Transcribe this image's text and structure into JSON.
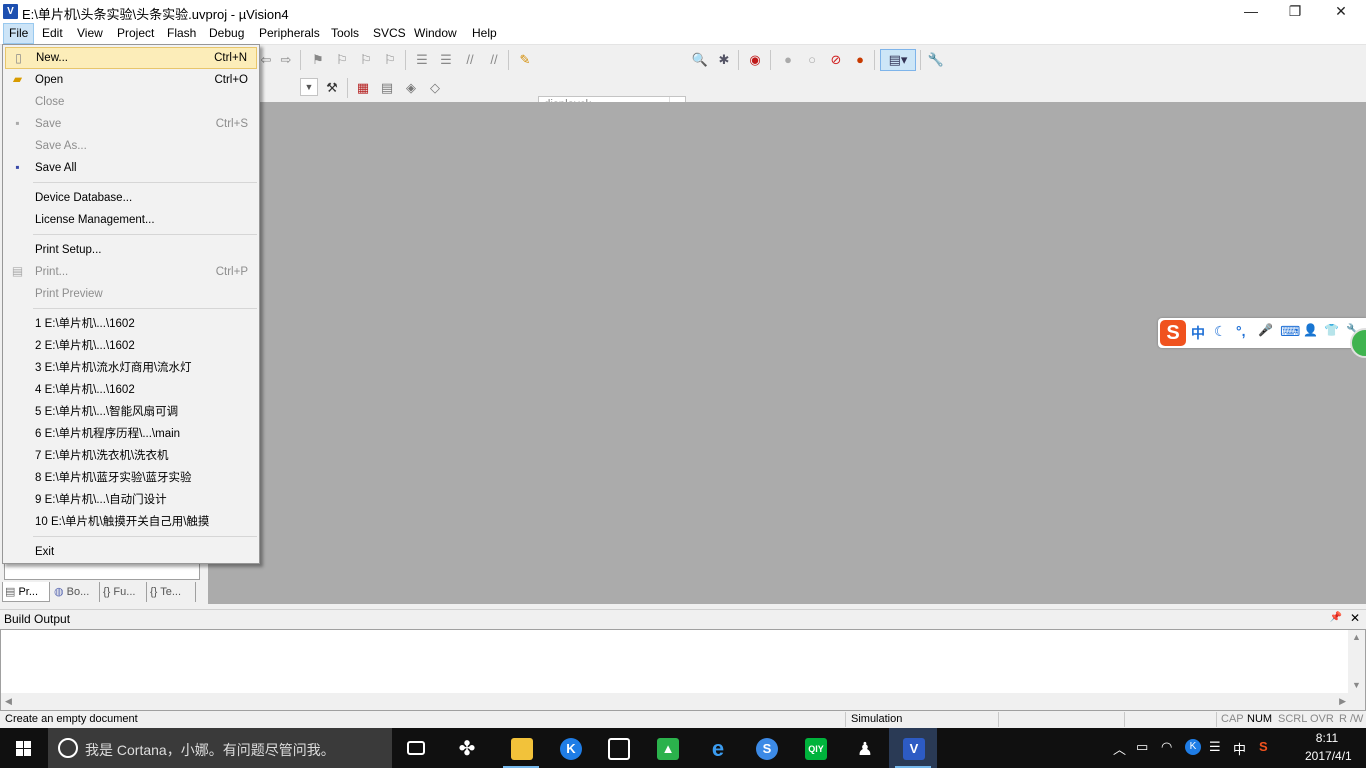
{
  "window": {
    "title": "E:\\单片机\\头条实验\\头条实验.uvproj - µVision4",
    "app_icon_text": "V",
    "controls": {
      "minimize": "—",
      "restore": "❐",
      "close": "✕"
    }
  },
  "menubar": {
    "items": [
      "File",
      "Edit",
      "View",
      "Project",
      "Flash",
      "Debug",
      "Peripherals",
      "Tools",
      "SVCS",
      "Window",
      "Help"
    ]
  },
  "toolbar": {
    "target_select": "displayck"
  },
  "file_menu": {
    "items": [
      {
        "label": "New...",
        "shortcut": "Ctrl+N",
        "icon": "new-file-icon",
        "highlighted": true,
        "disabled": false
      },
      {
        "label": "Open",
        "shortcut": "Ctrl+O",
        "icon": "open-folder-icon",
        "disabled": false
      },
      {
        "label": "Close",
        "shortcut": "",
        "disabled": true
      },
      {
        "label": "Save",
        "shortcut": "Ctrl+S",
        "icon": "save-icon",
        "disabled": true
      },
      {
        "label": "Save As...",
        "shortcut": "",
        "disabled": true
      },
      {
        "label": "Save All",
        "shortcut": "",
        "icon": "save-all-icon",
        "disabled": false
      },
      {
        "label": "Device Database...",
        "shortcut": "",
        "disabled": false
      },
      {
        "label": "License Management...",
        "shortcut": "",
        "disabled": false
      },
      {
        "label": "Print Setup...",
        "shortcut": "",
        "disabled": false
      },
      {
        "label": "Print...",
        "shortcut": "Ctrl+P",
        "icon": "print-icon",
        "disabled": true
      },
      {
        "label": "Print Preview",
        "shortcut": "",
        "disabled": true
      }
    ],
    "recent_files": [
      "1 E:\\单片机\\...\\1602",
      "2 E:\\单片机\\...\\1602",
      "3 E:\\单片机\\流水灯商用\\流水灯",
      "4 E:\\单片机\\...\\1602",
      "5 E:\\单片机\\...\\智能风扇可调",
      "6 E:\\单片机程序历程\\...\\main",
      "7 E:\\单片机\\洗衣机\\洗衣机",
      "8 E:\\单片机\\蓝牙实验\\蓝牙实验",
      "9 E:\\单片机\\...\\自动门设计",
      "10 E:\\单片机\\触摸开关自己用\\触摸"
    ],
    "exit": "Exit"
  },
  "panel_tabs": [
    "Pr...",
    "Bo...",
    "Fu...",
    "Te..."
  ],
  "build_output": {
    "title": "Build Output",
    "pin": "📌",
    "close": "✕"
  },
  "statusbar": {
    "message": "Create an empty document",
    "mode": "Simulation",
    "indicators": [
      "CAP",
      "NUM",
      "SCRL",
      "OVR",
      "R /W"
    ]
  },
  "ime_bar": {
    "logo": "S",
    "items": [
      "中",
      "☾",
      "°,",
      "🎤",
      "⌨",
      "👤",
      "👕",
      "🔧"
    ]
  },
  "taskbar": {
    "search_placeholder": "我是 Cortana，小娜。有问题尽管问我。",
    "tray": {
      "ime_lang": "中",
      "time": "8:11",
      "date": "2017/4/1"
    }
  }
}
